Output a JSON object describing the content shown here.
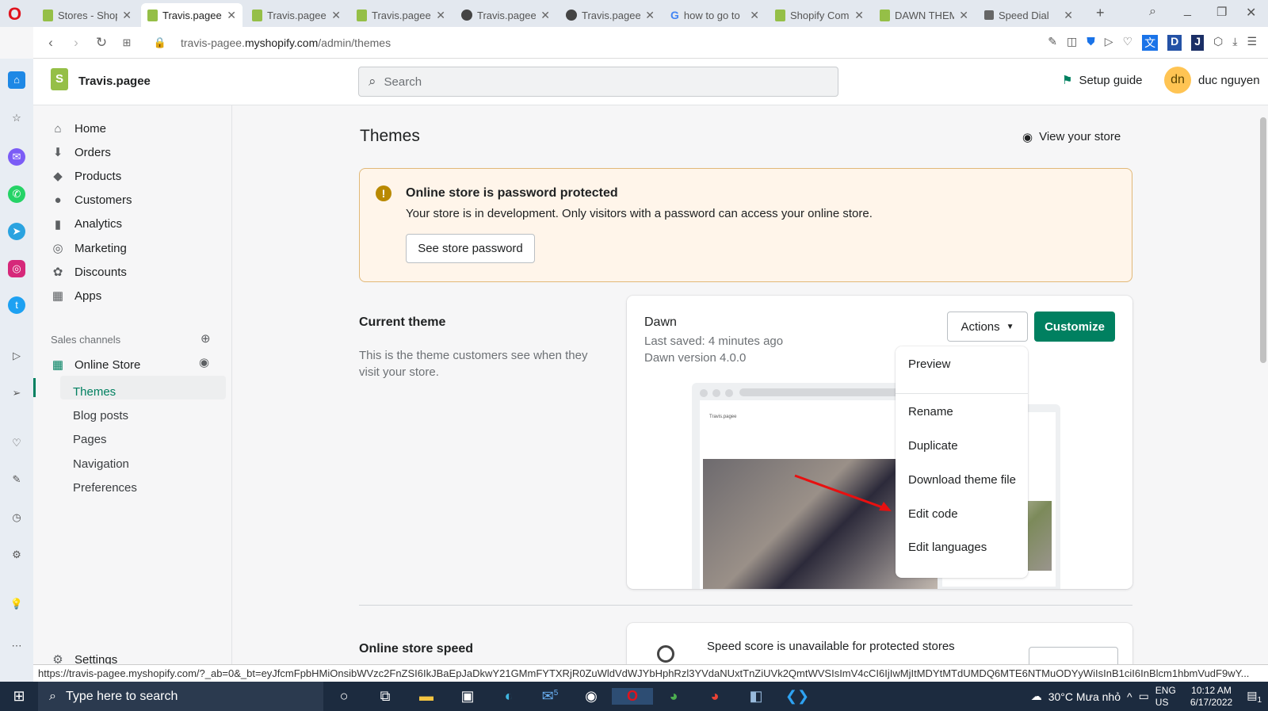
{
  "browser": {
    "tabs": [
      {
        "title": "Stores - Shop",
        "icon": "shopify-icon"
      },
      {
        "title": "Travis.pagee -",
        "icon": "shopify-icon",
        "active": true
      },
      {
        "title": "Travis.pagee -",
        "icon": "shopify-icon"
      },
      {
        "title": "Travis.pagee -",
        "icon": "shopify-icon"
      },
      {
        "title": "Travis.pagee",
        "icon": "globe-icon"
      },
      {
        "title": "Travis.pagee",
        "icon": "globe-icon"
      },
      {
        "title": "how to go to",
        "icon": "google-icon"
      },
      {
        "title": "Shopify Comm",
        "icon": "shopify-icon"
      },
      {
        "title": "DAWN THEME",
        "icon": "shopify-icon"
      },
      {
        "title": "Speed Dial",
        "icon": "speed-dial-icon"
      }
    ],
    "url_domain_prefix": "travis-pagee.",
    "url_domain": "myshopify.com",
    "url_path": "/admin/themes",
    "status_url": "https://travis-pagee.myshopify.com/?_ab=0&_bt=eyJfcmFpbHMiOnsibWVzc2FnZSI6IkJBaEpJaDkwY21GMmFYTXRjR0ZuWldVdWJYbHphRzl3YVdaNUxtTnZiUVk2QmtWVSIsImV4cCI6IjIwMjItMDYtMTdUMDQ6MTE6NTMuODYyWiIsInB1ciI6InBlcm1hbmVudF9wY..."
  },
  "shop": {
    "name": "Travis.pagee",
    "search_placeholder": "Search",
    "setup_guide": "Setup guide",
    "user_initials": "dn",
    "user_name": "duc nguyen"
  },
  "sidebar": {
    "items": [
      {
        "label": "Home"
      },
      {
        "label": "Orders"
      },
      {
        "label": "Products"
      },
      {
        "label": "Customers"
      },
      {
        "label": "Analytics"
      },
      {
        "label": "Marketing"
      },
      {
        "label": "Discounts"
      },
      {
        "label": "Apps"
      }
    ],
    "sales_channels": "Sales channels",
    "online_store": "Online Store",
    "sub": [
      {
        "label": "Themes"
      },
      {
        "label": "Blog posts"
      },
      {
        "label": "Pages"
      },
      {
        "label": "Navigation"
      },
      {
        "label": "Preferences"
      }
    ],
    "settings": "Settings"
  },
  "page": {
    "title": "Themes",
    "view_store": "View your store",
    "banner": {
      "title": "Online store is password protected",
      "text": "Your store is in development. Only visitors with a password can access your online store.",
      "button": "See store password"
    },
    "current_theme": {
      "heading": "Current theme",
      "desc": "This is the theme customers see when they visit your store.",
      "name": "Dawn",
      "last_saved": "Last saved: 4 minutes ago",
      "version": "Dawn version 4.0.0",
      "actions": "Actions",
      "customize": "Customize",
      "preview_store": "Travis.pagee"
    },
    "actions_menu": [
      "Preview",
      "Rename",
      "Duplicate",
      "Download theme file",
      "Edit code",
      "Edit languages"
    ],
    "speed": {
      "heading": "Online store speed",
      "text": "Speed score is unavailable for protected stores"
    }
  },
  "taskbar": {
    "search": "Type here to search",
    "weather": "30°C  Mưa nhỏ",
    "lang1": "ENG",
    "lang2": "US",
    "time": "10:12 AM",
    "date": "6/17/2022",
    "mail_badge": "5",
    "notif_badge": "1"
  },
  "colors": {
    "primary": "#008060",
    "banner_bg": "#fff5ea",
    "banner_border": "#e1b878",
    "warning": "#b98900"
  }
}
